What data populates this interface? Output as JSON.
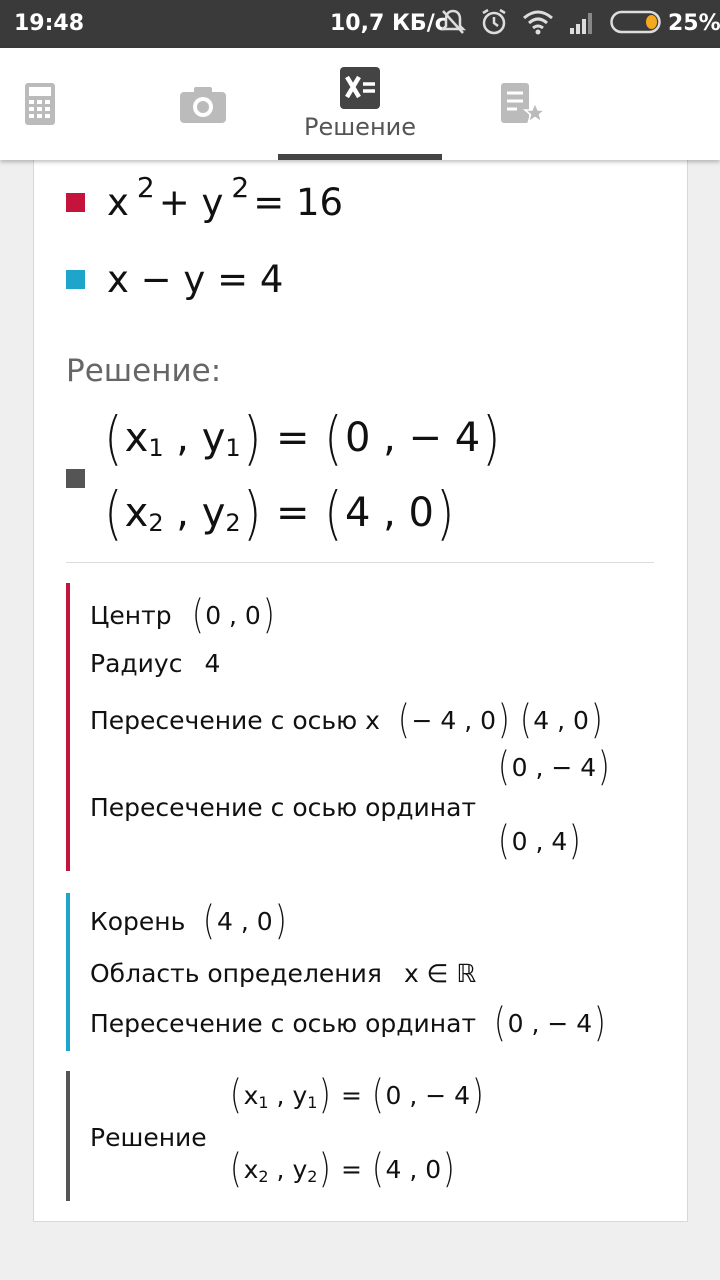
{
  "status_bar": {
    "time": "19:48",
    "speed": "10,7 КБ/с",
    "battery": "25%",
    "icons": [
      "mute-icon",
      "alarm-icon",
      "wifi-icon",
      "signal-icon",
      "battery-icon"
    ]
  },
  "tabs": [
    {
      "icon": "calculator-icon",
      "label": ""
    },
    {
      "icon": "camera-icon",
      "label": ""
    },
    {
      "icon": "solution-icon",
      "label": "Решение",
      "active": true
    },
    {
      "icon": "favorites-icon",
      "label": ""
    }
  ],
  "equations": [
    {
      "color": "#c5143c",
      "lhs_a": "x",
      "exp_a": "2",
      "plus": "+",
      "lhs_b": "y",
      "exp_b": "2",
      "rhs": "= 16"
    },
    {
      "color": "#1fa5cc",
      "text": "x − y = 4"
    }
  ],
  "solution_heading": "Решение:",
  "solution_marker_color": "#555555",
  "solutions": [
    {
      "x": "x",
      "xsub": "1",
      "y": "y",
      "ysub": "1",
      "value": "0 , − 4"
    },
    {
      "x": "x",
      "xsub": "2",
      "y": "y",
      "ysub": "2",
      "value": "4 , 0"
    }
  ],
  "circle_section": {
    "color": "#c5143c",
    "center_label": "Центр",
    "center_value": "0 , 0",
    "radius_label": "Радиус",
    "radius_value": "4",
    "x_intercept_label": "Пересечение с осью x",
    "x_intercepts": [
      "− 4 , 0",
      "4 , 0"
    ],
    "y_intercept_label": "Пересечение с осью ординат",
    "y_intercepts": [
      "0 , − 4",
      "0 , 4"
    ]
  },
  "line_section": {
    "color": "#1fa5cc",
    "root_label": "Корень",
    "root_value": "4 , 0",
    "domain_label": "Область определения",
    "domain_value": "x ∈ ℝ",
    "y_intercept_label": "Пересечение с осью ординат",
    "y_intercept_value": "0 , − 4"
  },
  "solution_section": {
    "color": "#555555",
    "label": "Решение",
    "rows": [
      {
        "x": "x",
        "xsub": "1",
        "y": "y",
        "ysub": "1",
        "value": "0 , − 4"
      },
      {
        "x": "x",
        "xsub": "2",
        "y": "y",
        "ysub": "2",
        "value": "4 , 0"
      }
    ]
  }
}
